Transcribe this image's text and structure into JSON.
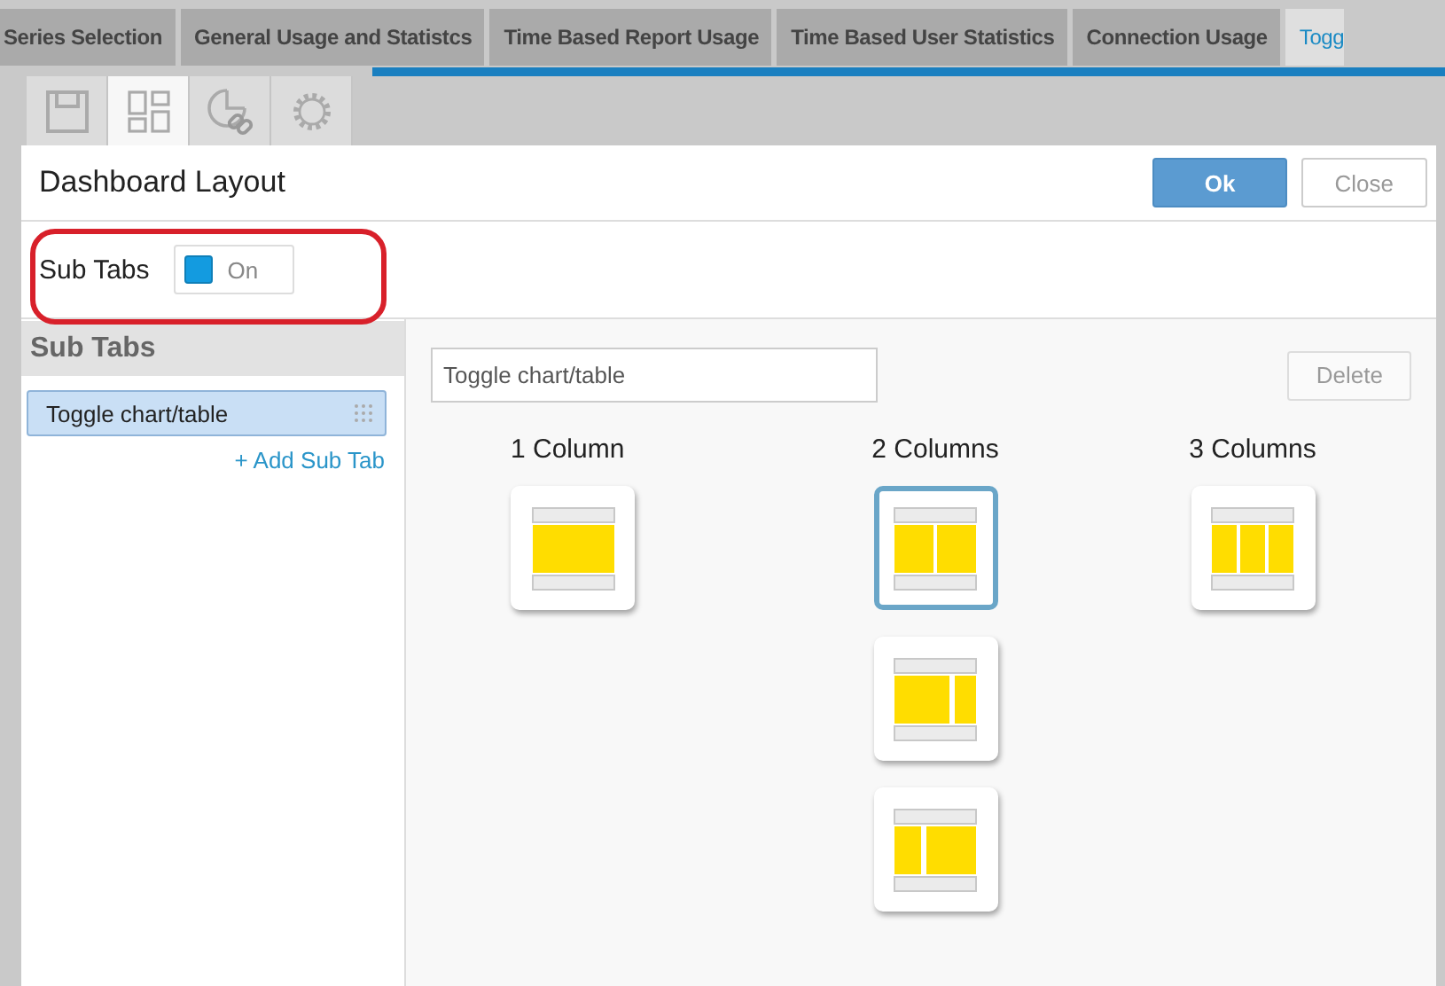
{
  "top_tabs": [
    {
      "label": "Series Selection",
      "selected": false
    },
    {
      "label": "General Usage and Statistcs",
      "selected": false
    },
    {
      "label": "Time Based Report Usage",
      "selected": false
    },
    {
      "label": "Time Based User Statistics",
      "selected": false
    },
    {
      "label": "Connection Usage",
      "selected": false
    },
    {
      "label": "Togg",
      "selected": true
    }
  ],
  "tool_tabs": [
    {
      "kind": "save",
      "selected": false
    },
    {
      "kind": "layout",
      "selected": true
    },
    {
      "kind": "chart-link",
      "selected": false
    },
    {
      "kind": "settings",
      "selected": false
    }
  ],
  "dialog": {
    "title": "Dashboard Layout",
    "buttons": [
      {
        "label": "Ok",
        "kind": "primary"
      },
      {
        "label": "Close",
        "kind": "secondary"
      }
    ],
    "sub_tabs_toggle": {
      "label": "Sub Tabs",
      "on": true,
      "state_text": "On",
      "highlighted": true
    },
    "sub_tabs_panel": {
      "title": "Sub Tabs",
      "items": [
        {
          "label": "Toggle chart/table",
          "selected": true
        }
      ],
      "add_link": "+ Add Sub Tab"
    },
    "editor": {
      "name_field": {
        "value": "Toggle chart/table"
      },
      "delete_button": "Delete",
      "columns": [
        {
          "label": "1 Column",
          "options": [
            {
              "kind": "single",
              "selected": false
            }
          ]
        },
        {
          "label": "2 Columns",
          "options": [
            {
              "kind": "two-equal",
              "selected": true
            },
            {
              "kind": "two-left-wide",
              "selected": false
            },
            {
              "kind": "two-right-wide",
              "selected": false
            }
          ]
        },
        {
          "label": "3 Columns",
          "options": [
            {
              "kind": "three",
              "selected": false
            }
          ]
        }
      ]
    }
  }
}
